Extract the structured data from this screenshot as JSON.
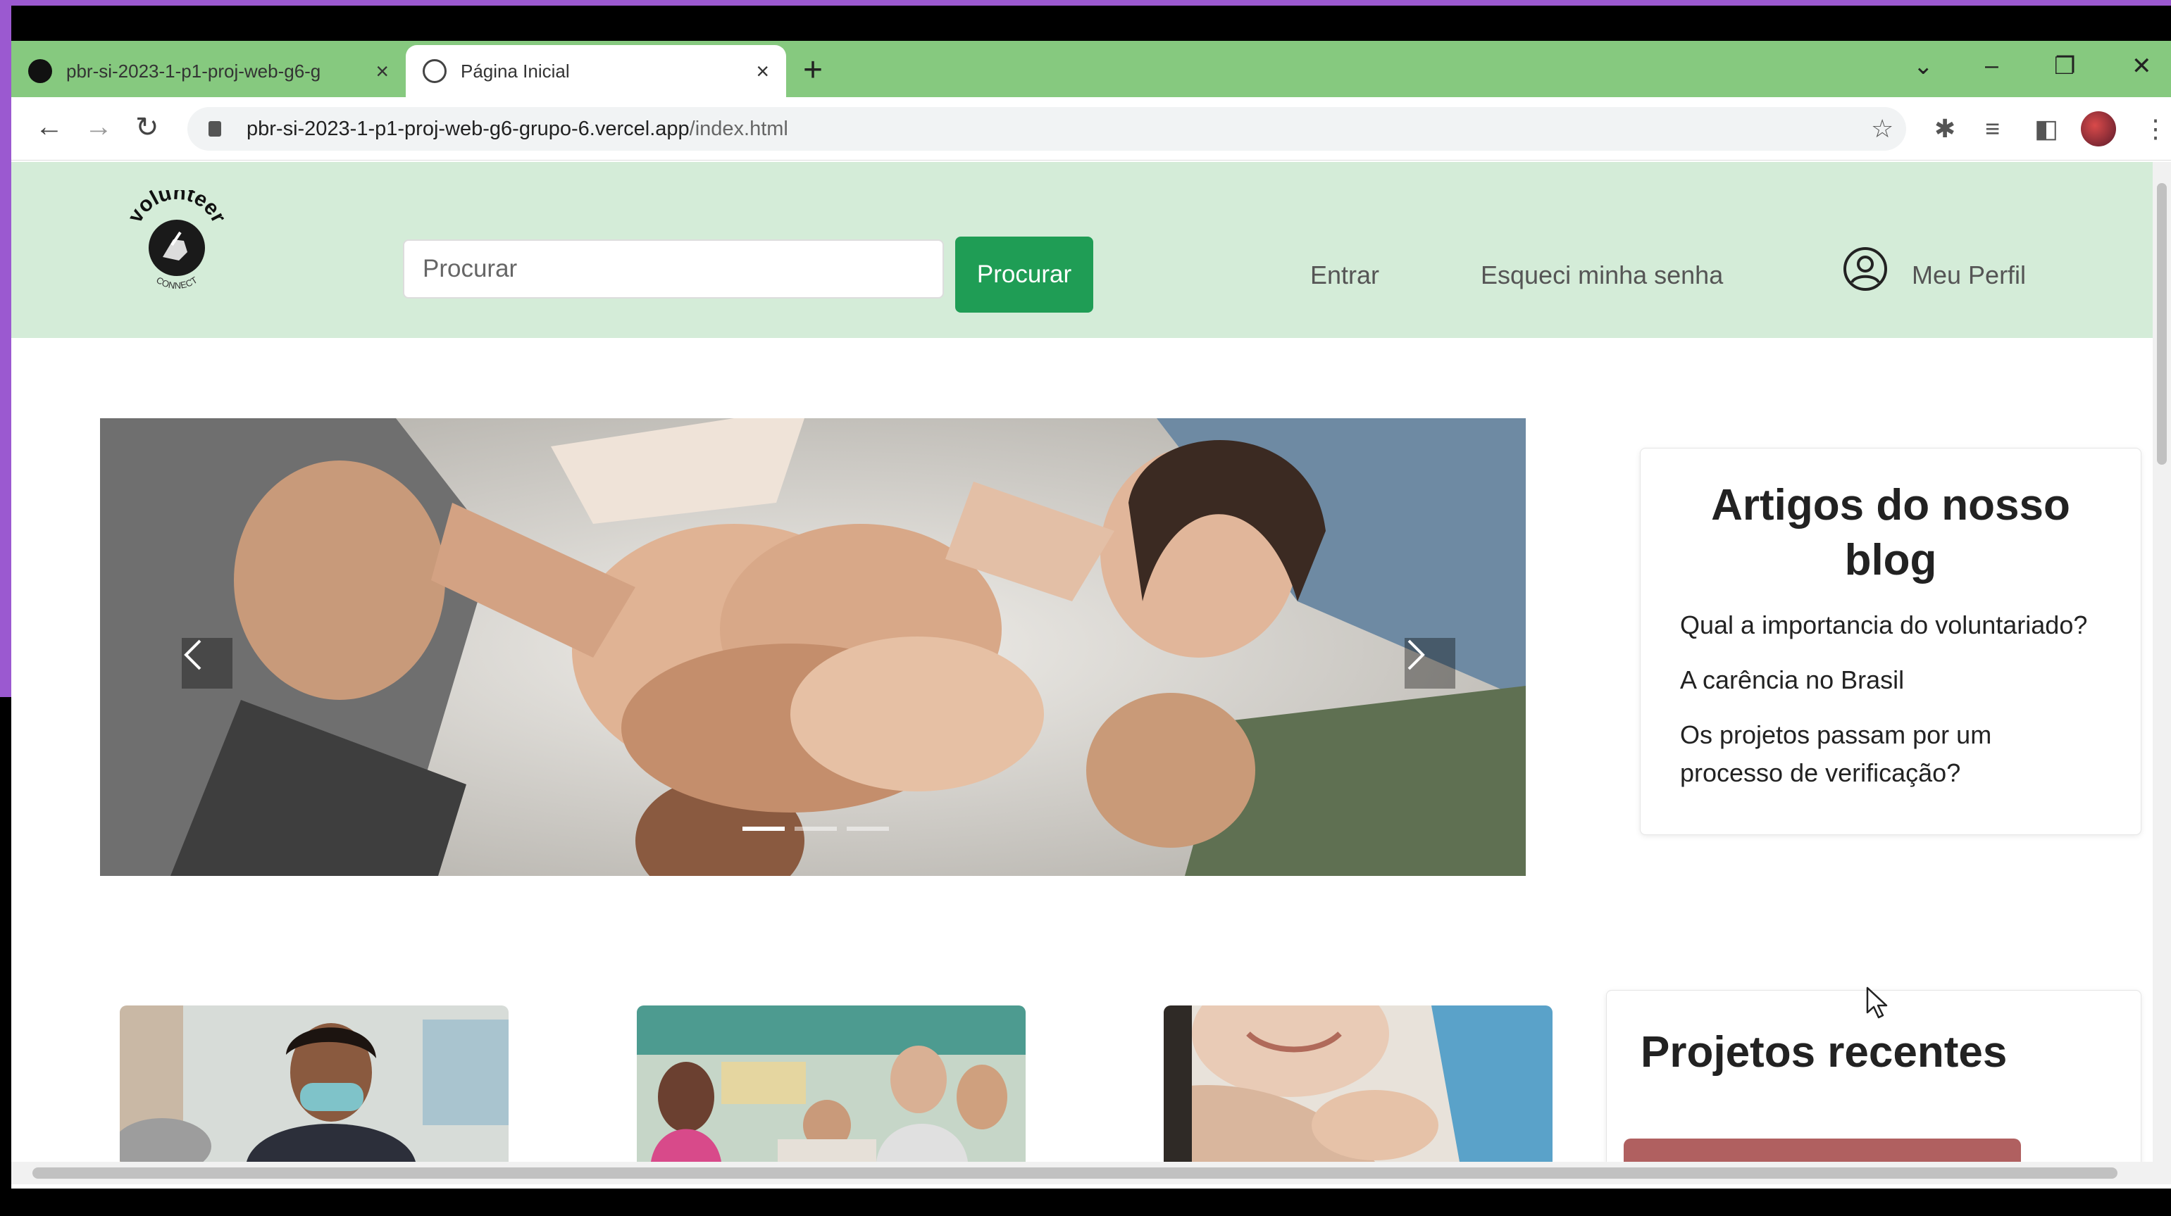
{
  "browser": {
    "tabs": [
      {
        "title": "pbr-si-2023-1-p1-proj-web-g6-g",
        "active": false
      },
      {
        "title": "Página Inicial",
        "active": true
      }
    ],
    "url_host": "pbr-si-2023-1-p1-proj-web-g6-grupo-6.vercel.app",
    "url_path": "/index.html"
  },
  "header": {
    "logo_text": "volunteer",
    "logo_subtext": "CONNECT",
    "search_placeholder": "Procurar",
    "search_button": "Procurar",
    "nav": {
      "login": "Entrar",
      "forgot": "Esqueci minha senha",
      "profile": "Meu Perfil"
    }
  },
  "blog": {
    "title": "Artigos do nosso blog",
    "links": [
      "Qual a importancia do voluntariado?",
      "A carência no Brasil",
      "Os projetos passam por um processo de verificação?"
    ]
  },
  "recent": {
    "title": "Projetos recentes"
  },
  "colors": {
    "tabbar": "#86c97f",
    "header_bg": "#d4ecd8",
    "button": "#1f9d55"
  }
}
